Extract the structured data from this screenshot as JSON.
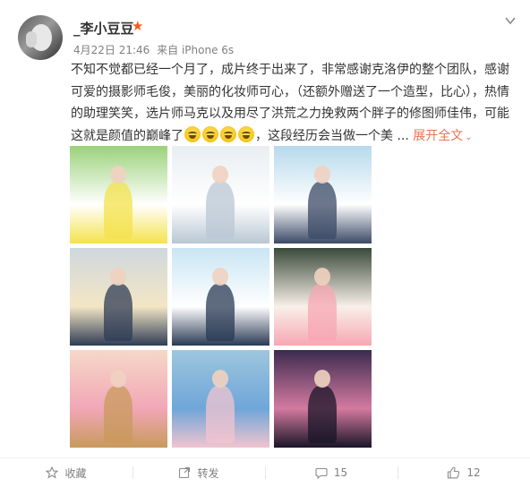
{
  "user": {
    "name": "_李小豆豆",
    "vip_color": "#f25c1d"
  },
  "meta": {
    "time": "4月22日 21:46",
    "source": "来自 iPhone 6s"
  },
  "post": {
    "text_before_emoji": "不知不觉都已经一个月了，成片终于出来了，非常感谢克洛伊的整个团队，感谢可爱的摄影师毛俊，美丽的化妆师可心，（还额外赠送了一个造型，比心），热情的助理笑笑，选片师马克以及用尽了洪荒之力挽救两个胖子的修图师佳伟，可能这就是颜值的巅峰了",
    "emoji_count": 4,
    "emoji_icon": "laugh-tears-icon",
    "text_after_emoji": "，这段经历会当做一个美 ...",
    "expand_label": "展开全文",
    "expand_color": "#eb7350"
  },
  "photos": [
    {
      "label": "photo-1",
      "colors": [
        "#9bd27a",
        "#ffffff",
        "#f4e24d"
      ]
    },
    {
      "label": "photo-2",
      "colors": [
        "#e9eef2",
        "#ffffff",
        "#b9c7d4"
      ]
    },
    {
      "label": "photo-3",
      "colors": [
        "#b7d9ec",
        "#ffffff",
        "#3b4a66"
      ]
    },
    {
      "label": "photo-4",
      "colors": [
        "#cfd8de",
        "#f3e6c5",
        "#2f3c55"
      ]
    },
    {
      "label": "photo-5",
      "colors": [
        "#c9e5f4",
        "#ffffff",
        "#2a3a54"
      ]
    },
    {
      "label": "photo-6",
      "colors": [
        "#3a4a3a",
        "#f8f0e8",
        "#f7a7b3"
      ]
    },
    {
      "label": "photo-7",
      "colors": [
        "#f6d8c8",
        "#f2a7b6",
        "#c89a5c"
      ]
    },
    {
      "label": "photo-8",
      "colors": [
        "#9ec6de",
        "#6fa6d9",
        "#f2c4cf"
      ]
    },
    {
      "label": "photo-9",
      "colors": [
        "#3b2b4f",
        "#d47aa0",
        "#1a1528"
      ]
    }
  ],
  "actions": {
    "favorite_label": "收藏",
    "repost_label": "转发",
    "comment_count": "15",
    "like_count": "12"
  },
  "colors": {
    "text": "#333333",
    "muted": "#808080",
    "accent": "#eb7350"
  }
}
